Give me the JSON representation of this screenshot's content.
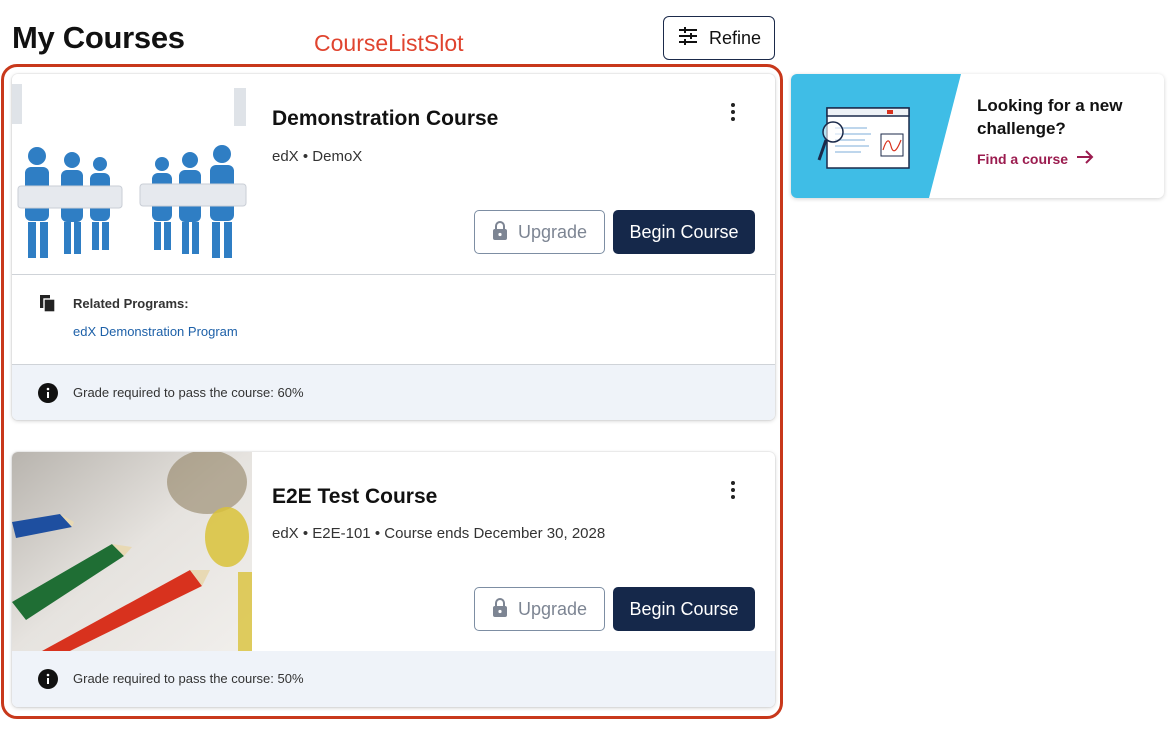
{
  "header": {
    "title": "My Courses",
    "slot_label": "CourseListSlot",
    "refine_label": "Refine"
  },
  "courses": [
    {
      "title": "Demonstration Course",
      "meta": "edX • DemoX",
      "upgrade_label": "Upgrade",
      "begin_label": "Begin Course",
      "related_heading": "Related Programs:",
      "related_link": "edX Demonstration Program",
      "grade_text": "Grade required to pass the course: 60%"
    },
    {
      "title": "E2E Test Course",
      "meta": "edX • E2E-101 • Course ends December 30, 2028",
      "upgrade_label": "Upgrade",
      "begin_label": "Begin Course",
      "grade_text": "Grade required to pass the course: 50%"
    }
  ],
  "promo": {
    "title": "Looking for a new challenge?",
    "link_label": "Find a course"
  },
  "colors": {
    "slot_outline": "#c8381b",
    "slot_label": "#e0442f",
    "primary_button": "#15284a",
    "link": "#1d60a8",
    "promo_link": "#9b1c4f",
    "promo_bg": "#3fbde6",
    "grade_bar_bg": "#eff3f9"
  },
  "icons": {
    "refine": "sliders-icon",
    "kebab": "more-vert-icon",
    "upgrade": "lock-icon",
    "related": "copy-doc-icon",
    "info": "info-icon",
    "promo_arrow": "arrow-right-icon"
  }
}
